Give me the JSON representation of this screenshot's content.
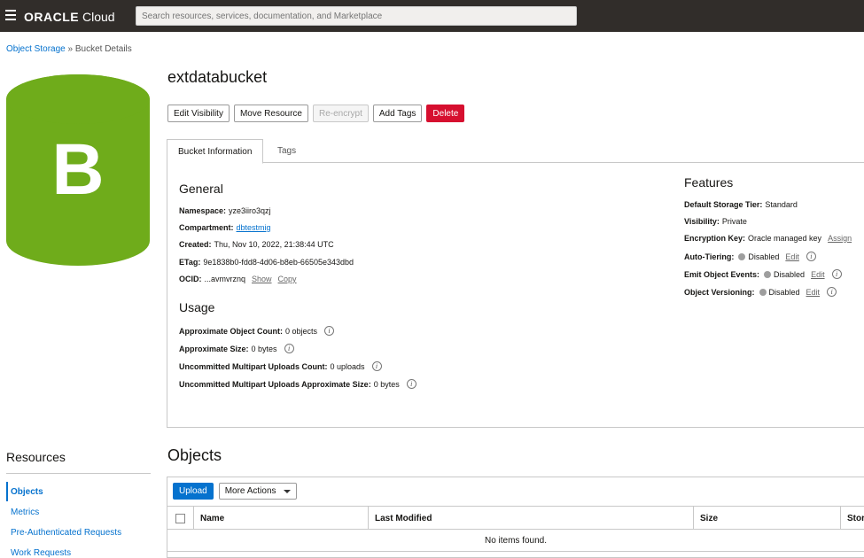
{
  "header": {
    "logo_bold": "ORACLE",
    "logo_rest": " Cloud",
    "search_placeholder": "Search resources, services, documentation, and Marketplace"
  },
  "breadcrumb": {
    "parent": "Object Storage",
    "separator": " » ",
    "current": "Bucket Details"
  },
  "bucket_icon": {
    "letter": "B",
    "color": "#6fac1b"
  },
  "title": "extdatabucket",
  "actions": {
    "edit_visibility": "Edit Visibility",
    "move_resource": "Move Resource",
    "re_encrypt": "Re-encrypt",
    "add_tags": "Add Tags",
    "delete": "Delete"
  },
  "tabs": {
    "bucket_information": "Bucket Information",
    "tags": "Tags"
  },
  "general": {
    "heading": "General",
    "namespace_label": "Namespace:",
    "namespace_value": "yze3iiro3qzj",
    "compartment_label": "Compartment:",
    "compartment_value": "dbtestmig",
    "created_label": "Created:",
    "created_value": "Thu, Nov 10, 2022, 21:38:44 UTC",
    "etag_label": "ETag:",
    "etag_value": "9e1838b0-fdd8-4d06-b8eb-66505e343dbd",
    "ocid_label": "OCID:",
    "ocid_value": "...avmvrznq",
    "show": "Show",
    "copy": "Copy"
  },
  "usage": {
    "heading": "Usage",
    "object_count_label": "Approximate Object Count:",
    "object_count_value": "0 objects",
    "size_label": "Approximate Size:",
    "size_value": "0 bytes",
    "multipart_count_label": "Uncommitted Multipart Uploads Count:",
    "multipart_count_value": "0 uploads",
    "multipart_size_label": "Uncommitted Multipart Uploads Approximate Size:",
    "multipart_size_value": "0 bytes"
  },
  "features": {
    "heading": "Features",
    "storage_tier_label": "Default Storage Tier:",
    "storage_tier_value": "Standard",
    "visibility_label": "Visibility:",
    "visibility_value": "Private",
    "encryption_label": "Encryption Key:",
    "encryption_value": "Oracle managed key",
    "assign": "Assign",
    "auto_tiering_label": "Auto-Tiering:",
    "auto_tiering_value": "Disabled",
    "emit_events_label": "Emit Object Events:",
    "emit_events_value": "Disabled",
    "versioning_label": "Object Versioning:",
    "versioning_value": "Disabled",
    "edit": "Edit"
  },
  "resources": {
    "heading": "Resources",
    "items": [
      "Objects",
      "Metrics",
      "Pre-Authenticated Requests",
      "Work Requests"
    ]
  },
  "objects": {
    "heading": "Objects",
    "upload": "Upload",
    "more_actions": "More Actions",
    "columns": [
      "Name",
      "Last Modified",
      "Size",
      "Stor"
    ],
    "empty": "No items found."
  }
}
